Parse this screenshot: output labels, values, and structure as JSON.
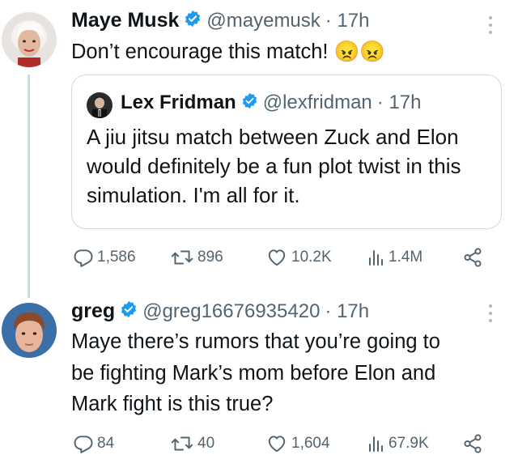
{
  "tweet1": {
    "name": "Maye Musk",
    "handle": "@mayemusk",
    "time": "· 17h",
    "text": "Don’t encourage this match! 😠😠",
    "avatar": "woman-white-hair-avatar"
  },
  "quote": {
    "name": "Lex Fridman",
    "handle": "@lexfridman",
    "time": "· 17h",
    "text": "A jiu jitsu match between Zuck and Elon would definitely be a fun plot twist in this simulation. I'm all for it.",
    "avatar": "man-suit-avatar"
  },
  "tweet1_actions": {
    "replies": "1,586",
    "reposts": "896",
    "likes": "10.2K",
    "views": "1.4M"
  },
  "tweet2": {
    "name": "greg",
    "handle": "@greg16676935420",
    "time": "· 17h",
    "text_lines": [
      "Maye there’s rumors that you’re going to",
      "be fighting Mark’s mom before Elon and",
      "Mark fight is this true?"
    ],
    "avatar": "red-hair-boy-avatar"
  },
  "tweet2_actions": {
    "replies": "84",
    "reposts": "40",
    "likes": "1,604",
    "views": "67.9K"
  },
  "colors": {
    "verified": "#1d9bf0",
    "secondary_text": "#536471",
    "border": "#cfd9de"
  }
}
